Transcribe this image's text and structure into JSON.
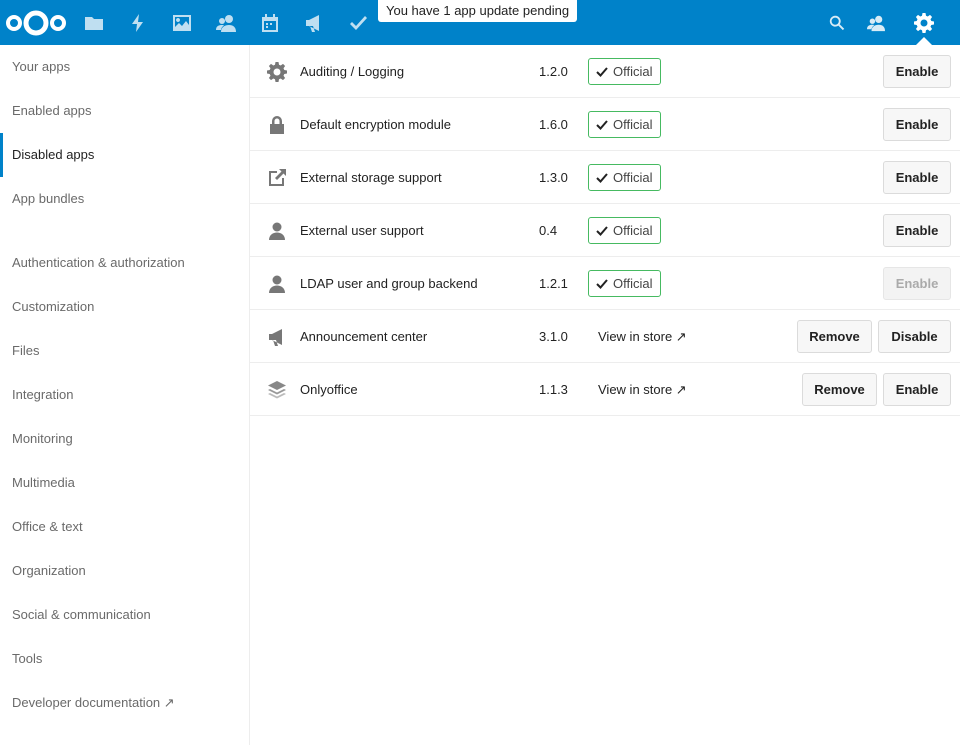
{
  "header": {
    "tooltip": "You have 1 app update pending",
    "nav_icons": [
      "files-icon",
      "activity-icon",
      "gallery-icon",
      "contacts-icon",
      "calendar-icon",
      "announcements-icon",
      "tasks-icon"
    ],
    "right_icons": [
      "search-icon",
      "contacts-menu-icon",
      "settings-icon"
    ],
    "accent_color": "#0082c9"
  },
  "sidebar": {
    "items": [
      {
        "label": "Your apps",
        "active": false
      },
      {
        "label": "Enabled apps",
        "active": false
      },
      {
        "label": "Disabled apps",
        "active": true
      },
      {
        "label": "App bundles",
        "active": false
      },
      {
        "label": "Authentication & authorization",
        "active": false
      },
      {
        "label": "Customization",
        "active": false
      },
      {
        "label": "Files",
        "active": false
      },
      {
        "label": "Integration",
        "active": false
      },
      {
        "label": "Monitoring",
        "active": false
      },
      {
        "label": "Multimedia",
        "active": false
      },
      {
        "label": "Office & text",
        "active": false
      },
      {
        "label": "Organization",
        "active": false
      },
      {
        "label": "Social & communication",
        "active": false
      },
      {
        "label": "Tools",
        "active": false
      },
      {
        "label": "Developer documentation ↗",
        "active": false
      }
    ]
  },
  "apps": [
    {
      "icon": "gear-icon",
      "name": "Auditing / Logging",
      "version": "1.2.0",
      "badge": "Official",
      "store": "",
      "remove": "",
      "action": "Enable",
      "action_disabled": false
    },
    {
      "icon": "lock-icon",
      "name": "Default encryption module",
      "version": "1.6.0",
      "badge": "Official",
      "store": "",
      "remove": "",
      "action": "Enable",
      "action_disabled": false
    },
    {
      "icon": "external-link-icon",
      "name": "External storage support",
      "version": "1.3.0",
      "badge": "Official",
      "store": "",
      "remove": "",
      "action": "Enable",
      "action_disabled": false
    },
    {
      "icon": "user-icon",
      "name": "External user support",
      "version": "0.4",
      "badge": "Official",
      "store": "",
      "remove": "",
      "action": "Enable",
      "action_disabled": false
    },
    {
      "icon": "user-icon",
      "name": "LDAP user and group backend",
      "version": "1.2.1",
      "badge": "Official",
      "store": "",
      "remove": "",
      "action": "Enable",
      "action_disabled": true
    },
    {
      "icon": "megaphone-icon",
      "name": "Announcement center",
      "version": "3.1.0",
      "badge": "",
      "store": "View in store ↗",
      "remove": "Remove",
      "action": "Disable",
      "action_disabled": false
    },
    {
      "icon": "layers-icon",
      "name": "Onlyoffice",
      "version": "1.1.3",
      "badge": "",
      "store": "View in store ↗",
      "remove": "Remove",
      "action": "Enable",
      "action_disabled": false
    }
  ]
}
